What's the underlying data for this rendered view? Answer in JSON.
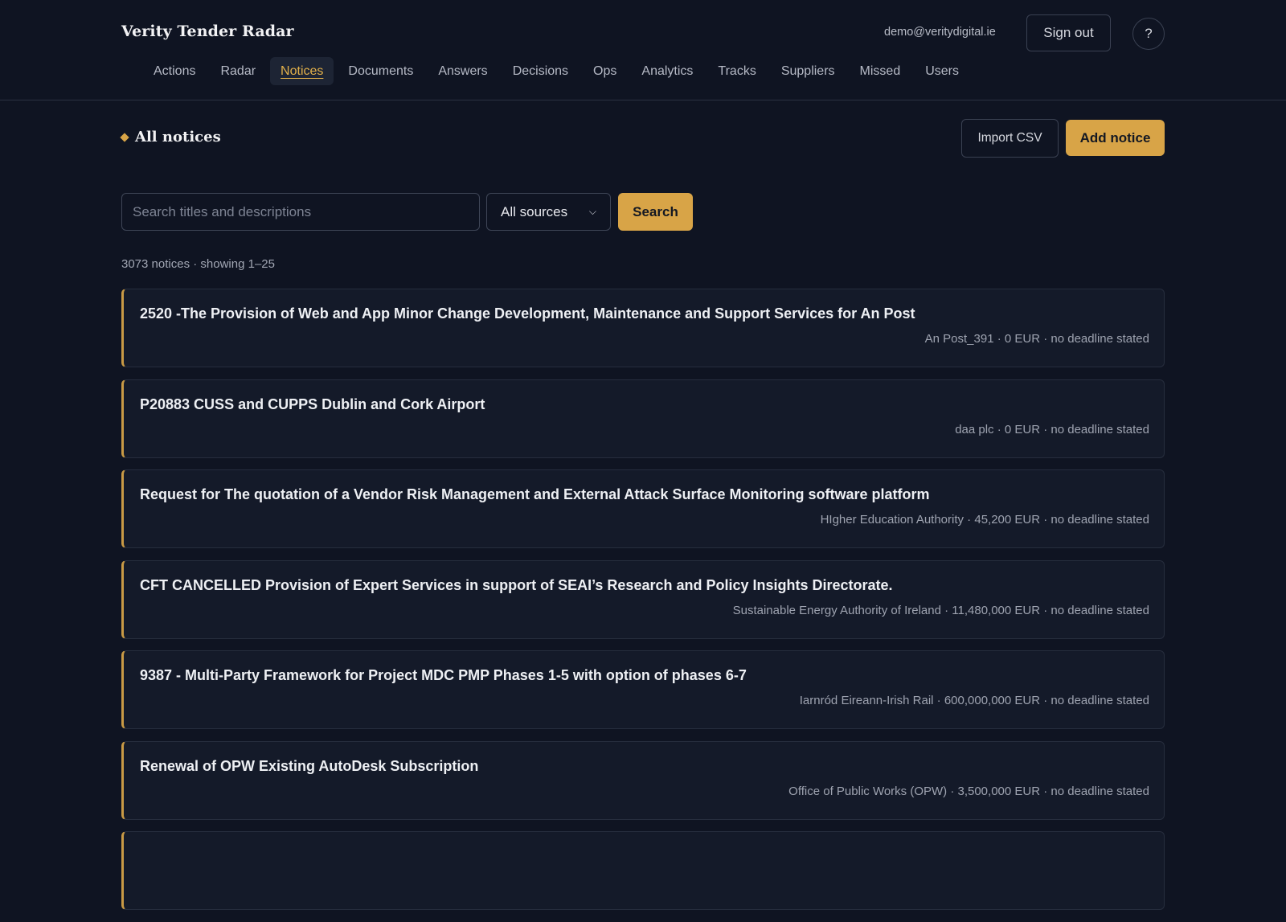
{
  "header": {
    "brand": "Verity Tender Radar",
    "user_email": "demo@veritydigital.ie",
    "sign_out_label": "Sign out",
    "help_label": "?"
  },
  "nav": {
    "items": [
      "Actions",
      "Radar",
      "Notices",
      "Documents",
      "Answers",
      "Decisions",
      "Ops",
      "Analytics",
      "Tracks",
      "Suppliers",
      "Missed",
      "Users"
    ],
    "active": "Notices"
  },
  "section": {
    "title": "All notices",
    "import_label": "Import CSV",
    "add_label": "Add notice"
  },
  "search": {
    "placeholder": "Search titles and descriptions",
    "value": "",
    "source_selected": "All sources",
    "button_label": "Search"
  },
  "results": {
    "summary": "3073 notices · showing 1–25",
    "notices": [
      {
        "title": "2520 -The Provision of Web and App Minor Change Development, Maintenance and Support Services for An Post",
        "meta": "An Post_391 · 0 EUR · no deadline stated"
      },
      {
        "title": "P20883 CUSS and CUPPS Dublin and Cork Airport",
        "meta": "daa plc · 0 EUR · no deadline stated"
      },
      {
        "title": "Request for The quotation of a Vendor Risk Management and External Attack Surface Monitoring software platform",
        "meta": "HIgher Education Authority · 45,200 EUR · no deadline stated"
      },
      {
        "title": "CFT CANCELLED Provision of Expert Services in support of SEAI’s Research and Policy Insights Directorate.",
        "meta": "Sustainable Energy Authority of Ireland · 11,480,000 EUR · no deadline stated"
      },
      {
        "title": "9387 - Multi-Party Framework for Project MDC PMP Phases 1-5 with option of phases 6-7",
        "meta": "Iarnród Eireann-Irish Rail · 600,000,000 EUR · no deadline stated"
      },
      {
        "title": "Renewal of OPW Existing AutoDesk Subscription",
        "meta": "Office of Public Works (OPW) · 3,500,000 EUR · no deadline stated"
      },
      {
        "title": "",
        "meta": ""
      }
    ]
  }
}
